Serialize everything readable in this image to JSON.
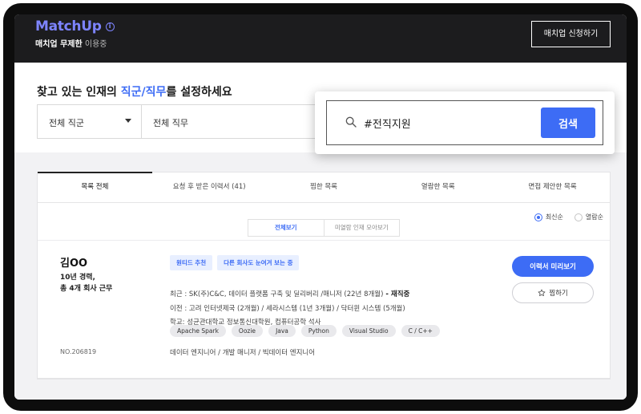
{
  "header": {
    "logo": "MatchUp",
    "info_icon": "info-icon",
    "subtitle_bold": "매치업 무제한",
    "subtitle_light": "이용중",
    "apply_button": "매치업 신청하기"
  },
  "filter": {
    "title_prefix": "찾고 있는 인재의 ",
    "title_accent": "직군/직무",
    "title_suffix": "를 설정하세요",
    "job_group": "전체 직군",
    "job_duty": "전체 직무"
  },
  "search": {
    "value": "#전직지원",
    "button": "검색",
    "icon": "search-icon"
  },
  "tabs": [
    {
      "label": "목록 전체"
    },
    {
      "label": "요청 후 받은 이력서 (41)"
    },
    {
      "label": "찜한 목록"
    },
    {
      "label": "열람한 목록"
    },
    {
      "label": "면접 제안한 목록"
    }
  ],
  "sort": {
    "latest": "최신순",
    "viewed": "열람순"
  },
  "segment": {
    "all": "전체보기",
    "unviewed": "미열람 인재 모아보기"
  },
  "candidate": {
    "name": "김OO",
    "years": "10년 경력,",
    "companies": "총 4개 회사 근무",
    "no": "NO.206819",
    "badges": [
      "원티드 추천",
      "다른 회사도 눈여겨 보는 중"
    ],
    "recent_text": "최근 : SK(주)C&C, 데이터 플랫폼 구축 및 딜리버리 /매니저 (22년 8개월)",
    "recent_status": " - 재직중",
    "previous": "이전 : 고려 인터넷제국 (2개월) / 세라시스템 (1년 3개월) / 닥터윈 시스템 (5개월)",
    "education": "학교: 성균관대학교 정보통신대학원, 컴퓨터공학 석사",
    "skills": [
      "Apache Spark",
      "Oozie",
      "Java",
      "Python",
      "Visual Studio",
      "C / C++"
    ],
    "roles": "데이터 엔지니어 / 개발 매니저 / 빅데이터 엔지니어",
    "preview_button": "이력서 미리보기",
    "fav_button": "찜하기",
    "fav_icon": "star-icon"
  }
}
